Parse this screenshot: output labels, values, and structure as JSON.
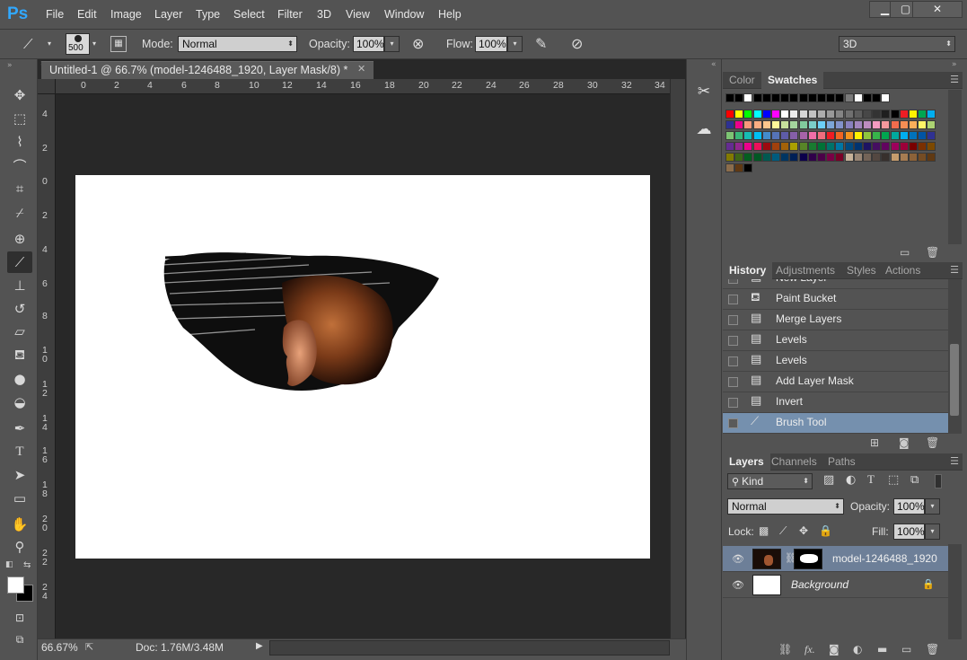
{
  "app": {
    "logo": "Ps"
  },
  "menu": [
    "File",
    "Edit",
    "Image",
    "Layer",
    "Type",
    "Select",
    "Filter",
    "3D",
    "View",
    "Window",
    "Help"
  ],
  "window_controls": {
    "minimize": "▁",
    "maximize": "▢",
    "close": "✕"
  },
  "options": {
    "brush_size": "500",
    "mode_label": "Mode:",
    "mode_value": "Normal",
    "opacity_label": "Opacity:",
    "opacity_value": "100%",
    "flow_label": "Flow:",
    "flow_value": "100%",
    "workspace": "3D"
  },
  "document": {
    "tab_title": "Untitled-1 @ 66.7% (model-1246488_1920, Layer Mask/8) *",
    "ruler_h": [
      "0",
      "2",
      "4",
      "6",
      "8",
      "10",
      "12",
      "14",
      "16",
      "18",
      "20",
      "22",
      "24",
      "26",
      "28",
      "30",
      "32",
      "34"
    ],
    "ruler_v": [
      "4",
      "2",
      "0",
      "2",
      "4",
      "6",
      "8",
      "1 0",
      "1 2",
      "1 4",
      "1 6",
      "1 8",
      "2 0",
      "2 2",
      "2 4"
    ]
  },
  "status": {
    "zoom": "66.67%",
    "doc": "Doc: 1.76M/3.48M"
  },
  "swatches_panel": {
    "tabs": [
      "Color",
      "Swatches"
    ],
    "active_tab": "Swatches",
    "rows": [
      [
        "#000000",
        "#000000",
        "#ffffff",
        "#000000",
        "#000000",
        "#000000",
        "#000000",
        "#000000",
        "#000000",
        "#000000",
        "#000000",
        "#000000",
        "#000000",
        "#7a7a7a",
        "#ffffff",
        "#000000",
        "#000000",
        "#ffffff"
      ],
      [
        "#ff0000",
        "#ffff00",
        "#00ff00",
        "#00ffff",
        "#0000ff",
        "#ff00ff",
        "#ffffff",
        "#ebebeb",
        "#d6d6d6",
        "#c2c2c2",
        "#adadad",
        "#999999",
        "#858585",
        "#707070",
        "#5c5c5c",
        "#474747",
        "#333333",
        "#1f1f1f",
        "#000000",
        "#ee1d24",
        "#fff200",
        "#00a651",
        "#00aeef"
      ],
      [
        "#2e3192",
        "#ec008c",
        "#f7977a",
        "#fbad82",
        "#fdc68c",
        "#fff799",
        "#c6df9c",
        "#a4d49d",
        "#81ca9d",
        "#7bcdc9",
        "#6ccff7",
        "#7ca6d8",
        "#8293ca",
        "#8881be",
        "#a286bd",
        "#bc8cbf",
        "#f49bc1",
        "#f5999d",
        "#f16c4d",
        "#f68e54",
        "#fbaf5a",
        "#fff467",
        "#acd372"
      ],
      [
        "#7dc473",
        "#39b778",
        "#16bcb4",
        "#00bff3",
        "#438ccb",
        "#5573b7",
        "#5e5ca7",
        "#855fa8",
        "#a763a9",
        "#ef6ea8",
        "#f16d7e",
        "#ee1d24",
        "#f16522",
        "#f7941d",
        "#fff100",
        "#8fc63d",
        "#37b44a",
        "#00a650",
        "#00a99e",
        "#00aeef",
        "#0072bc",
        "#0054a5",
        "#2f3192"
      ],
      [
        "#652c91",
        "#91278f",
        "#ed008c",
        "#ee105a",
        "#9d0a0f",
        "#a1410d",
        "#a36209",
        "#aba000",
        "#588528",
        "#197b30",
        "#007236",
        "#00736a",
        "#0076a4",
        "#004a80",
        "#003370",
        "#1d1363",
        "#450e61",
        "#62055f",
        "#9e005c",
        "#9d0039",
        "#790000",
        "#7b3000",
        "#7c4900"
      ],
      [
        "#827a00",
        "#3e6617",
        "#045f20",
        "#005824",
        "#005951",
        "#005b7e",
        "#003562",
        "#002056",
        "#0c004b",
        "#30004a",
        "#4b0048",
        "#7a0045",
        "#7a0026",
        "#c7b299",
        "#998675",
        "#736357",
        "#534741",
        "#37302d",
        "#c69c6d",
        "#a67c52",
        "#8c6239",
        "#754c24",
        "#603913"
      ],
      [
        "#8b6d4c",
        "#603913",
        "#000000"
      ]
    ]
  },
  "history_panel": {
    "tabs": [
      "History",
      "Adjustments",
      "Styles",
      "Actions"
    ],
    "active_tab": "History",
    "items": [
      {
        "label": "New Layer",
        "icon": "document-icon",
        "glyph": "▤",
        "active": false
      },
      {
        "label": "Paint Bucket",
        "icon": "paint-bucket-icon",
        "glyph": "⛾",
        "active": false
      },
      {
        "label": "Merge Layers",
        "icon": "document-icon",
        "glyph": "▤",
        "active": false
      },
      {
        "label": "Levels",
        "icon": "document-icon",
        "glyph": "▤",
        "active": false
      },
      {
        "label": "Levels",
        "icon": "document-icon",
        "glyph": "▤",
        "active": false
      },
      {
        "label": "Add Layer Mask",
        "icon": "document-icon",
        "glyph": "▤",
        "active": false
      },
      {
        "label": "Invert",
        "icon": "document-icon",
        "glyph": "▤",
        "active": false
      },
      {
        "label": "Brush Tool",
        "icon": "brush-icon",
        "glyph": "⟋",
        "active": true
      }
    ]
  },
  "layers_panel": {
    "tabs": [
      "Layers",
      "Channels",
      "Paths"
    ],
    "active_tab": "Layers",
    "filter_value": "Kind",
    "blend_mode": "Normal",
    "opacity_label": "Opacity:",
    "opacity_value": "100%",
    "lock_label": "Lock:",
    "fill_label": "Fill:",
    "fill_value": "100%",
    "layers": [
      {
        "name": "model-1246488_1920",
        "selected": true
      },
      {
        "name": "Background",
        "selected": false
      }
    ],
    "footer_icons": [
      "link-icon",
      "fx-icon",
      "mask-icon",
      "adjustment-icon",
      "folder-icon",
      "new-layer-icon",
      "trash-icon"
    ],
    "footer_fx": "fx."
  },
  "colors": {
    "accent": "#31a8ff",
    "selection": "#7590ae",
    "foreground": "#ffffff",
    "background": "#000000"
  }
}
